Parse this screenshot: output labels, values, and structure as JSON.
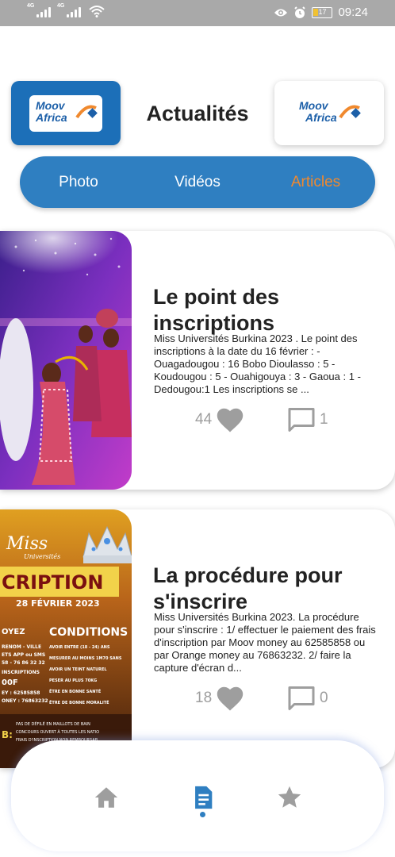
{
  "status_bar": {
    "signal_tags": [
      "4G",
      "4G"
    ],
    "battery": "17",
    "time": "09:24"
  },
  "header": {
    "title": "Actualités",
    "logo_text_line1": "Moov",
    "logo_text_line2": "Africa"
  },
  "tabs": [
    {
      "label": "Photo",
      "active": false
    },
    {
      "label": "Vidéos",
      "active": false
    },
    {
      "label": "Articles",
      "active": true
    }
  ],
  "articles": [
    {
      "title": "Le point des inscriptions",
      "excerpt": "Miss Universités Burkina 2023 . Le point des inscriptions à la date du 16 février : - Ouagadougou : 16 Bobo Dioulasso : 5 - Koudougou : 5 - Ouahigouya : 3 - Gaoua : 1 - Dedougou:1 Les inscriptions se ...",
      "likes": "44",
      "comments": "1"
    },
    {
      "title": "La procédure pour s'inscrire",
      "excerpt": "Miss Universités Burkina 2023. La procédure pour s'inscrire : 1/ effectuer le paiement des frais d'inscription par Moov money au 62585858 ou par Orange money au 76863232. 2/ faire la capture d'écran d...",
      "likes": "18",
      "comments": "0"
    }
  ],
  "poster": {
    "brand": "Miss",
    "brand_sub": "Universités",
    "heading": "CRIPTION",
    "date": "28 FÉVRIER 2023",
    "conditions_title": "CONDITIONS",
    "payez": "OYEZ",
    "left_lines": [
      "RENOM - VILLE",
      "ETS APP ou SMS",
      "58 - 76 86 32 32",
      "INSCRIPTIONS",
      "00F",
      "EY : 62585858",
      "ONEY : 76863232"
    ],
    "conditions": [
      "AVOIR ENTRE (18 - 24) ANS",
      "MESURER AU MOINS 1M70 SANS",
      "AVOIR UN TEINT NATUREL",
      "PESER AU PLUS 70KG",
      "ÊTRE EN BONNE SANTÉ",
      "ÊTRE DE BONNE MORALITÉ"
    ],
    "bottom_prefix": "B:",
    "bottom_lines": [
      "PAS DE DÉFILÉ EN MAILLOTS DE BAIN",
      "CONCOURS OUVERT À TOUTES LES NATIO",
      "FRAIS D'INSCRIPTION NON REMBOURSAB"
    ]
  },
  "bottom_nav": [
    {
      "icon": "home-icon",
      "active": false
    },
    {
      "icon": "article-icon",
      "active": true
    },
    {
      "icon": "star-icon",
      "active": false
    }
  ],
  "colors": {
    "primary": "#2f7fc1",
    "accent": "#f0892e",
    "status_bar": "#a9a9a9"
  }
}
